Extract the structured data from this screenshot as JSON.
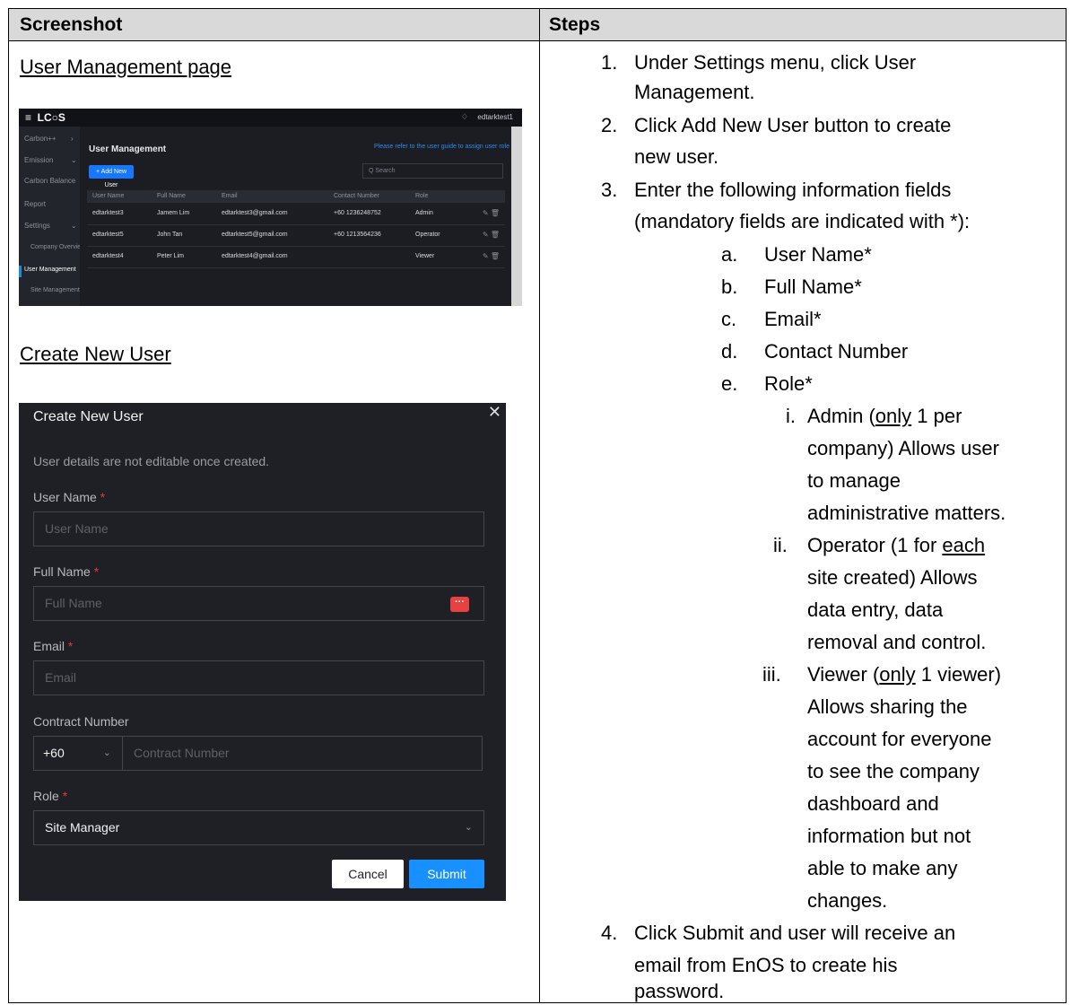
{
  "table_header": {
    "screenshot": "Screenshot",
    "steps": "Steps"
  },
  "section1_label": "User Management page",
  "section2_label": "Create New User",
  "um_screenshot": {
    "logo": "LC○S",
    "user": "edtarktest1",
    "sidebar": [
      {
        "label": "Carbon++",
        "sub": false
      },
      {
        "label": "Emission",
        "sub": false
      },
      {
        "label": "Carbon Balance",
        "sub": false
      },
      {
        "label": "Report",
        "sub": false
      },
      {
        "label": "Settings",
        "sub": false
      },
      {
        "label": "Company Overview",
        "sub": true
      },
      {
        "label": "User Management",
        "sub": true
      },
      {
        "label": "Site Management",
        "sub": true
      }
    ],
    "title": "User Management",
    "notice": "Please refer to the user guide to assign user role",
    "add_button": "+ Add New User",
    "search_placeholder": "Q Search",
    "columns": [
      "User Name",
      "Full Name",
      "Email",
      "Contact Number",
      "Role"
    ],
    "rows": [
      [
        "edtarktest3",
        "Jamem Lim",
        "edtarktest3@gmail.com",
        "+60 1236248752",
        "Admin"
      ],
      [
        "edtarktest5",
        "John Tan",
        "edtarktest5@gmail.com",
        "+60 1213564236",
        "Operator"
      ],
      [
        "edtarktest4",
        "Peter Lim",
        "edtarktest4@gmail.com",
        "",
        "Viewer"
      ]
    ]
  },
  "create_user_modal": {
    "title": "Create New User",
    "close": "✕",
    "note": "User details are not editable once created.",
    "fields": {
      "user_name": {
        "label": "User Name",
        "placeholder": "User Name"
      },
      "full_name": {
        "label": "Full Name",
        "placeholder": "Full Name"
      },
      "email": {
        "label": "Email",
        "placeholder": "Email"
      },
      "contact": {
        "label": "Contract Number",
        "country_code": "+60",
        "placeholder": "Contract Number"
      },
      "role": {
        "label": "Role",
        "value": "Site Manager"
      }
    },
    "required_mark": "*",
    "cancel": "Cancel",
    "submit": "Submit"
  },
  "steps": {
    "s1_num": "1.",
    "s1_a": "Under Settings menu, click User",
    "s1_b": "Management.",
    "s2_num": "2.",
    "s2_a": "Click Add New User button to create",
    "s2_b": "new user.",
    "s3_num": "3.",
    "s3_a": "Enter the following information fields",
    "s3_b": "(mandatory fields are indicated with *):",
    "a_num": "a.",
    "a": "User Name*",
    "b_num": "b.",
    "b": "Full Name*",
    "c_num": "c.",
    "c": "Email*",
    "d_num": "d.",
    "d": "Contact Number",
    "e_num": "e.",
    "e": "Role*",
    "i_num": "i.",
    "i_1a": "Admin (",
    "i_1u": "only",
    "i_1b": " 1 per",
    "i_2": "company) Allows user",
    "i_3": "to manage",
    "i_4": "administrative matters.",
    "ii_num": "ii.",
    "ii_1a": "Operator (1 for ",
    "ii_1u": "each",
    "ii_2": "site created) Allows",
    "ii_3": "data entry, data",
    "ii_4": "removal and control.",
    "iii_num": "iii.",
    "iii_1a": "Viewer (",
    "iii_1u": "only",
    "iii_1b": " 1 viewer)",
    "iii_2": "Allows sharing the",
    "iii_3": "account for everyone",
    "iii_4": "to see the company",
    "iii_5": "dashboard and",
    "iii_6": "information but not",
    "iii_7": "able to make any",
    "iii_8": "changes.",
    "s4_num": "4.",
    "s4_a": "Click Submit and user will receive an",
    "s4_b": "email from EnOS to create his",
    "s4_c": "password."
  }
}
